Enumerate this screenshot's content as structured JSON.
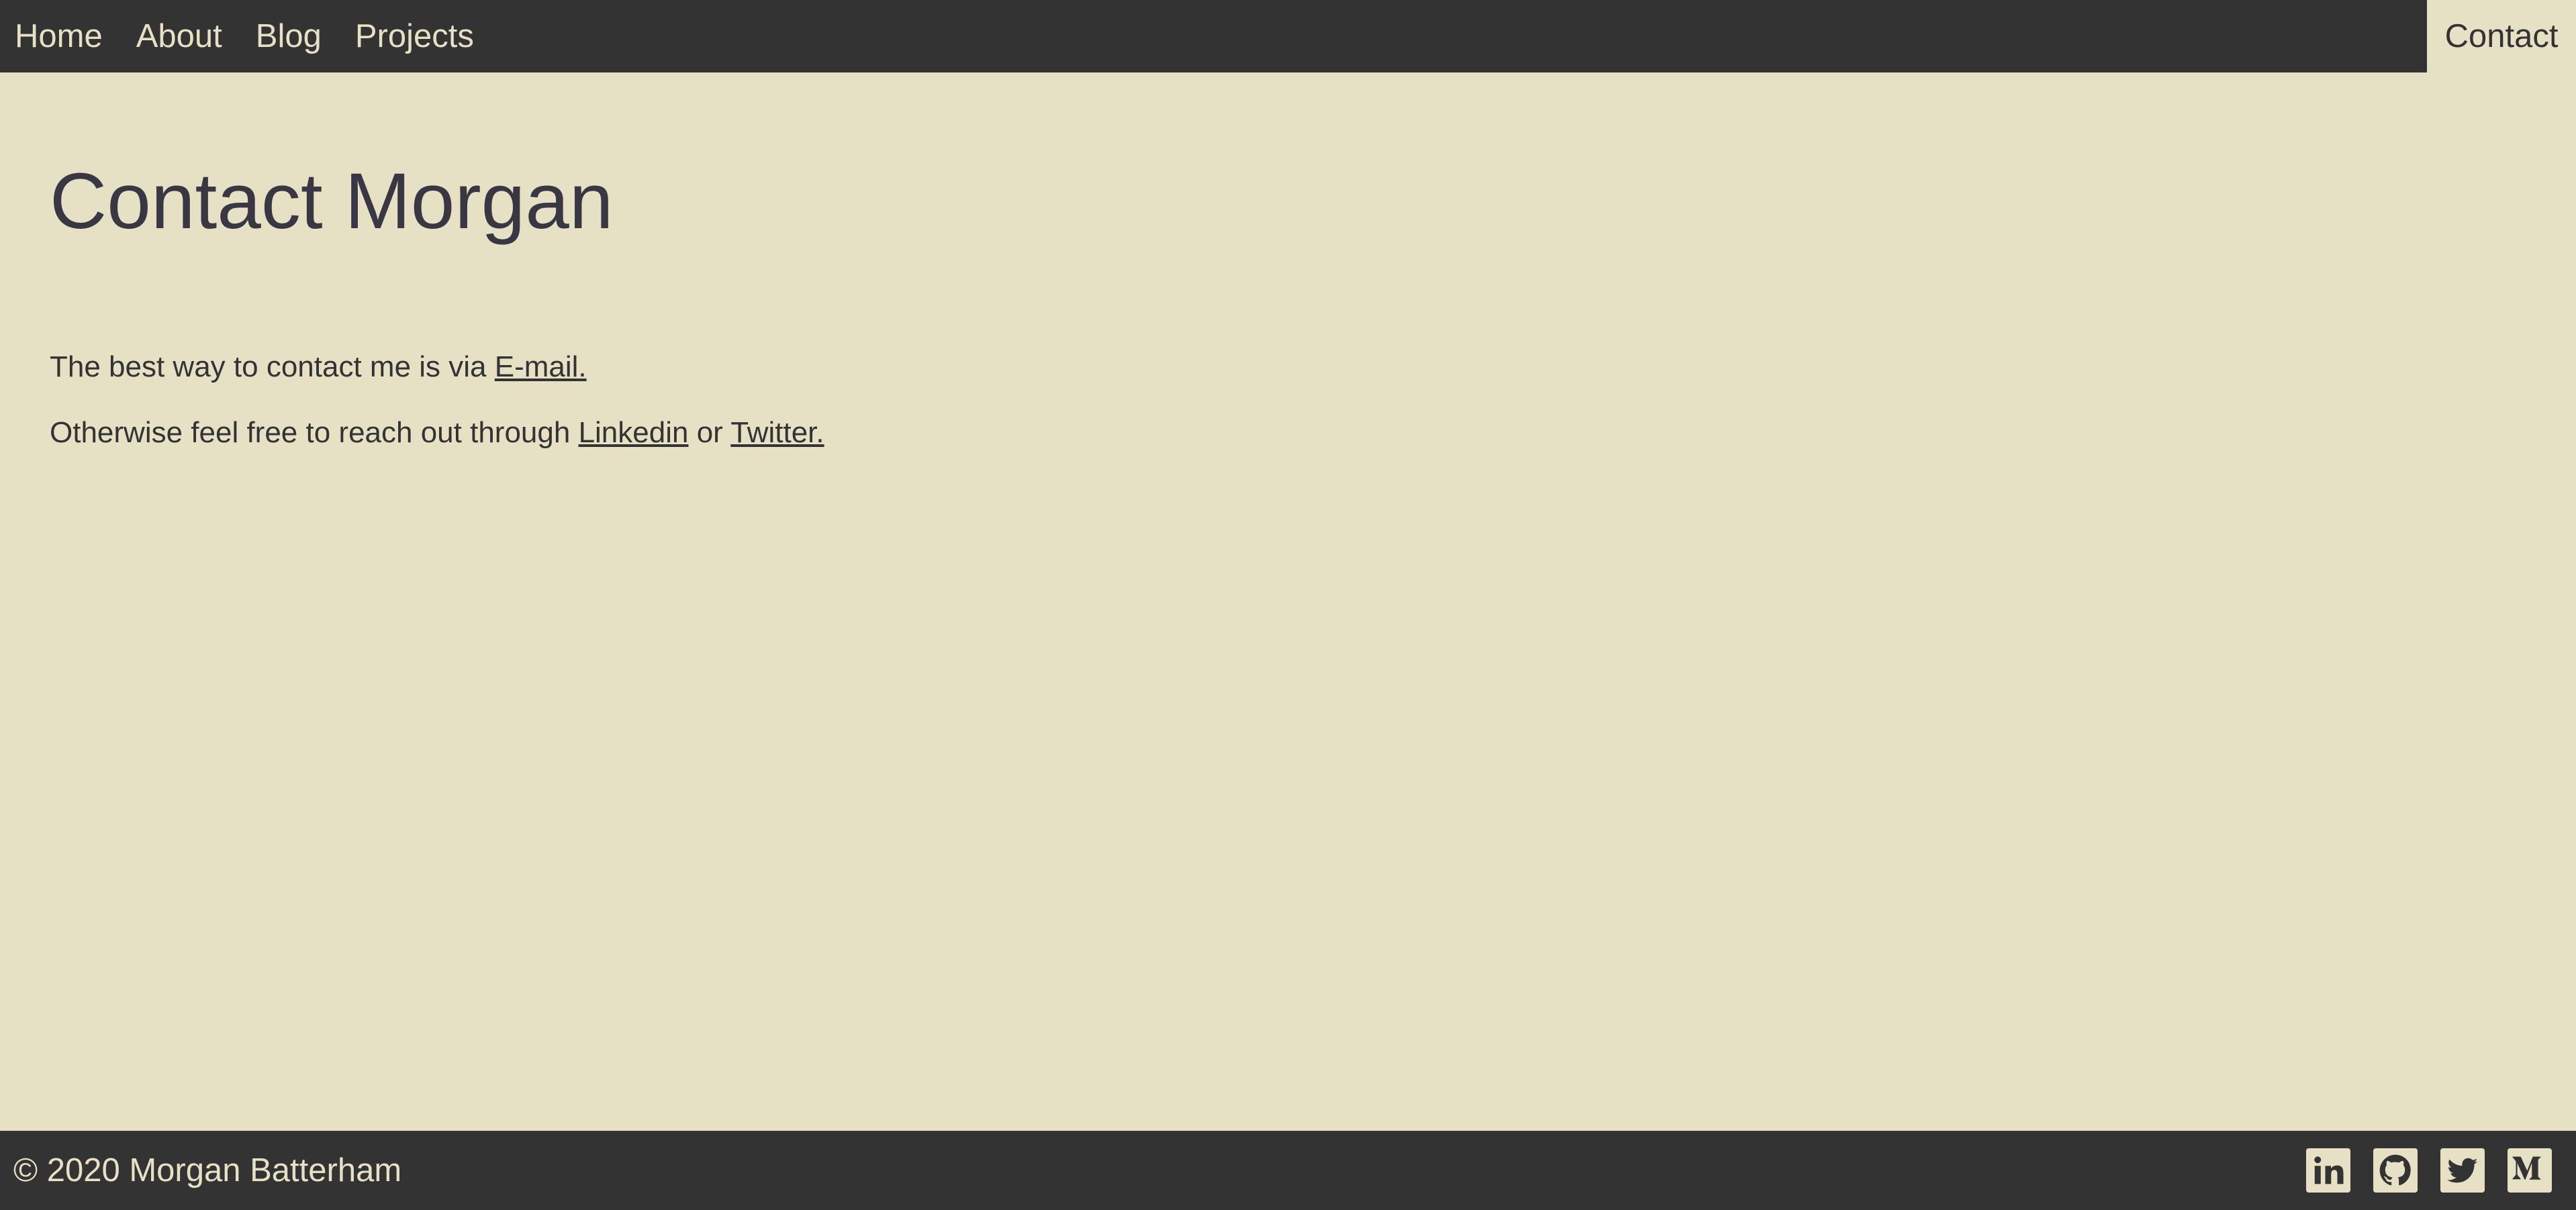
{
  "nav": {
    "items": [
      {
        "label": "Home"
      },
      {
        "label": "About"
      },
      {
        "label": "Blog"
      },
      {
        "label": "Projects"
      }
    ],
    "active_label": "Contact"
  },
  "main": {
    "title": "Contact Morgan",
    "line1": {
      "text": "The best way to contact me is via ",
      "link": "E-mail."
    },
    "line2": {
      "text": "Otherwise feel free to reach out through ",
      "link1": "Linkedin",
      "middle": " or ",
      "link2": "Twitter."
    }
  },
  "footer": {
    "copyright": "© 2020 Morgan Batterham",
    "social": [
      {
        "icon": "linkedin-icon"
      },
      {
        "icon": "github-icon"
      },
      {
        "icon": "twitter-icon"
      },
      {
        "icon": "medium-icon"
      }
    ]
  },
  "colors": {
    "background": "#e6e1c5",
    "bar": "#333333",
    "title": "#3a3744",
    "text": "#333333"
  }
}
